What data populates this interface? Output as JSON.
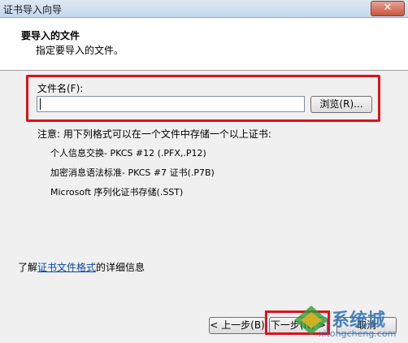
{
  "window": {
    "title": "证书导入向导",
    "close_icon": "close-icon"
  },
  "header": {
    "title": "要导入的文件",
    "subtitle": "指定要导入的文件。"
  },
  "file": {
    "label": "文件名(F):",
    "value": "",
    "browse_label": "浏览(R)..."
  },
  "note": "注意: 用下列格式可以在一个文件中存储一个以上证书:",
  "formats": [
    "个人信息交换- PKCS #12 (.PFX,.P12)",
    "加密消息语法标准- PKCS #7 证书(.P7B)",
    "Microsoft 序列化证书存储(.SST)"
  ],
  "more_info": {
    "prefix": "了解",
    "link": "证书文件格式",
    "suffix": "的详细信息"
  },
  "buttons": {
    "back": "< 上一步(B)",
    "next": "下一步(N) >",
    "cancel": "取消"
  },
  "watermark": {
    "text": "系统城",
    "url": "xitongcheng.com"
  },
  "colors": {
    "highlight": "#e0101c",
    "link": "#0645ad",
    "watermark": "#2a6fb6"
  }
}
